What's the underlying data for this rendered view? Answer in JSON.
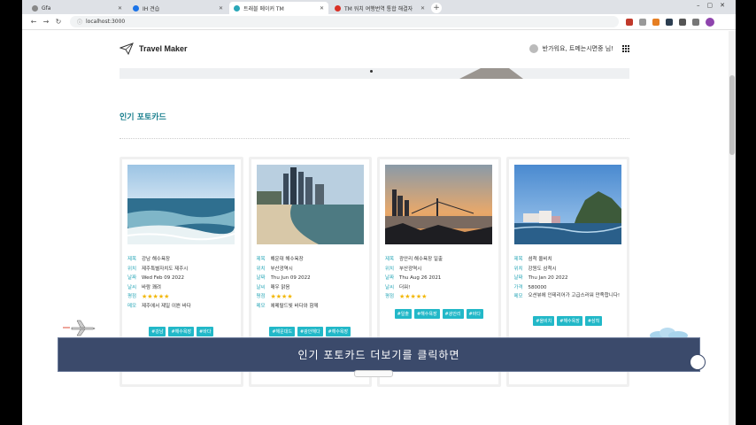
{
  "browser": {
    "tabs": [
      {
        "label": "Gfa",
        "active": false
      },
      {
        "label": "IH 견습",
        "active": false
      },
      {
        "label": "트래블 메이커 TM",
        "active": true
      },
      {
        "label": "TM 워치 여행번역 통합 해결자",
        "active": false
      }
    ],
    "url": "localhost:3000",
    "new_tab": "+"
  },
  "site": {
    "brand": "Travel Maker",
    "greeting": "반가워요, 트메는시면중 님!"
  },
  "section": {
    "title": "인기 포토카드"
  },
  "cards": [
    {
      "rows": [
        {
          "label": "제목",
          "value": "강남 해수욕장"
        },
        {
          "label": "위치",
          "value": "제주특별자치도 제주시"
        },
        {
          "label": "날짜",
          "value": "Wed Feb 09 2022"
        },
        {
          "label": "날씨",
          "value": "바람 쾌려"
        },
        {
          "label": "평점",
          "value": "★★★★★",
          "stars": true
        },
        {
          "label": "메모",
          "value": "제주에서 제일 이쁜 바다"
        }
      ],
      "tags": [
        "#강남",
        "#해수욕장",
        "#바다"
      ],
      "photo": "sea-waves"
    },
    {
      "rows": [
        {
          "label": "제목",
          "value": "해운대 해수욕장"
        },
        {
          "label": "위치",
          "value": "부산광역시"
        },
        {
          "label": "날짜",
          "value": "Thu Jun 09 2022"
        },
        {
          "label": "날씨",
          "value": "매우 맑음"
        },
        {
          "label": "평점",
          "value": "★★★★",
          "stars": true
        },
        {
          "label": "메모",
          "value": "에메랄드빛 바다와 함께"
        }
      ],
      "tags": [
        "#해운대드",
        "#광안해다",
        "#해수욕장"
      ],
      "photo": "city-beach"
    },
    {
      "rows": [
        {
          "label": "제목",
          "value": "광안리 해수욕장 일출"
        },
        {
          "label": "위치",
          "value": "부산광역시"
        },
        {
          "label": "날짜",
          "value": "Thu Aug 26 2021"
        },
        {
          "label": "날씨",
          "value": "더워!"
        },
        {
          "label": "평점",
          "value": "★★★★★",
          "stars": true
        }
      ],
      "tags": [
        "#일출",
        "#해수욕장",
        "#광안리",
        "#바다"
      ],
      "photo": "sunset-bridge"
    },
    {
      "rows": [
        {
          "label": "제목",
          "value": "섬척 올비치"
        },
        {
          "label": "위치",
          "value": "강원도 삼척시"
        },
        {
          "label": "날짜",
          "value": "Thu Jan 20 2022"
        },
        {
          "label": "가격",
          "value": "580000"
        },
        {
          "label": "메모",
          "value": "오션뷰에 인테리어가 고급스러워 만족합니다!"
        }
      ],
      "tags": [
        "#올비치",
        "#해수욕장",
        "#삼척"
      ],
      "photo": "cliff-resort"
    }
  ],
  "overlay": {
    "subtitle": "인기 포토카드 더보기를 클릭하면"
  },
  "colors": {
    "accent": "#22b8c8",
    "title": "#1a7f8e",
    "subtitle_bg": "#3b4a6b"
  }
}
